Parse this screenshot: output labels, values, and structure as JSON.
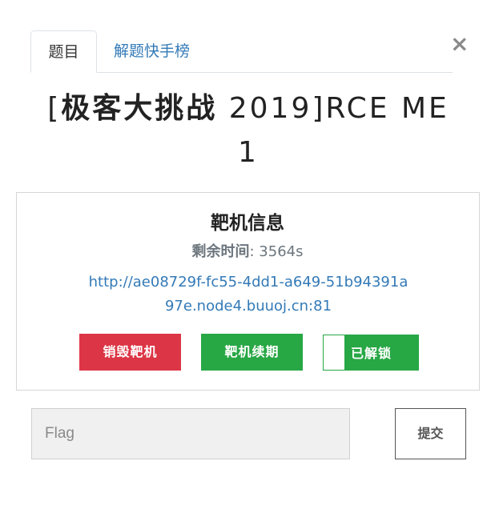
{
  "tabs": {
    "challenge_label": "题目",
    "leaderboard_label": "解题快手榜"
  },
  "close_icon": "×",
  "challenge": {
    "title_prefix": "[",
    "title_cn": "极客大挑战",
    "title_suffix": " 2019]RCE ME 1"
  },
  "instance": {
    "heading": "靶机信息",
    "remaining_label": "剩余时间",
    "remaining_sep": ": ",
    "remaining_value": "3564s",
    "url": "http://ae08729f-fc55-4dd1-a649-51b94391a97e.node4.buuoj.cn:81",
    "destroy_label": "销毁靶机",
    "renew_label": "靶机续期",
    "unlocked_label": "已解锁"
  },
  "flag_form": {
    "placeholder": "Flag",
    "value": "",
    "submit_label": "提交"
  },
  "colors": {
    "link": "#337ab7",
    "danger": "#dc3545",
    "success": "#28a745"
  }
}
